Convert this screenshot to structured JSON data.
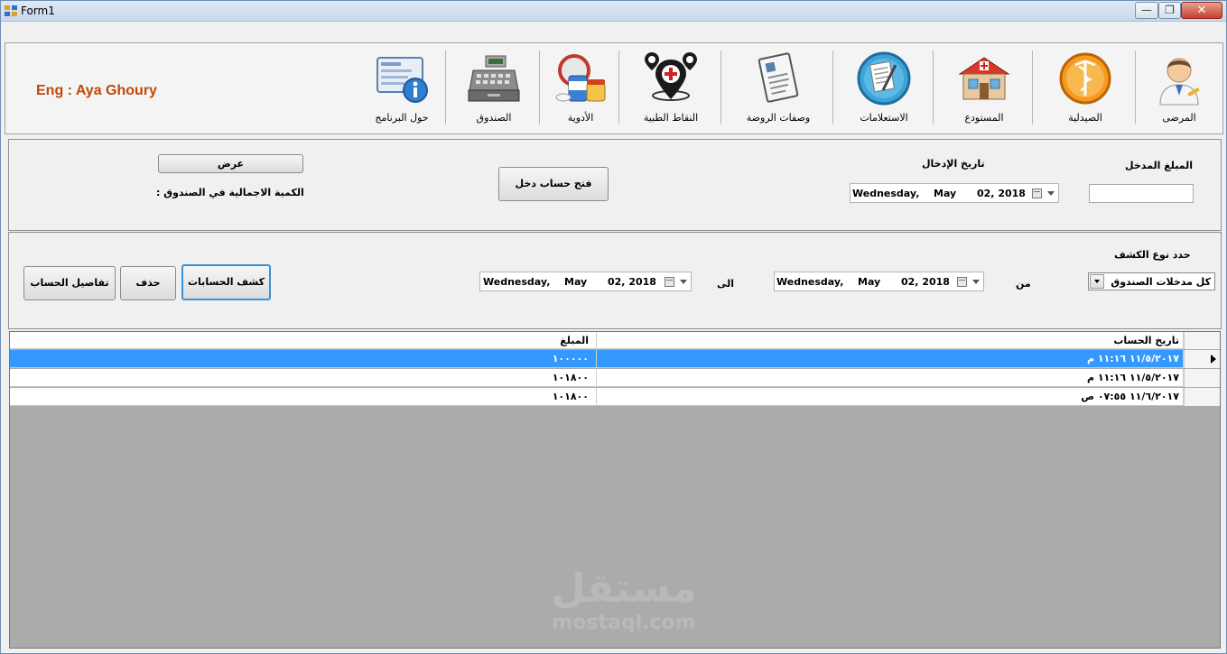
{
  "window": {
    "title": "Form1",
    "minimize": "0",
    "maximize": "1",
    "close": "r"
  },
  "toolbar": {
    "author": "Eng : Aya Ghoury",
    "items": [
      {
        "label": "حول البرنامج",
        "icon": "info-icon"
      },
      {
        "label": "الصندوق",
        "icon": "cash-register-icon"
      },
      {
        "label": "الأدوية",
        "icon": "medicine-icon"
      },
      {
        "label": "النقاط الطبية",
        "icon": "medical-pins-icon"
      },
      {
        "label": "وصفات الروضة",
        "icon": "prescription-icon"
      },
      {
        "label": "الاستعلامات",
        "icon": "query-icon"
      },
      {
        "label": "المستودع",
        "icon": "warehouse-icon"
      },
      {
        "label": "الصيدلية",
        "icon": "pharmacy-icon"
      },
      {
        "label": "المرضى",
        "icon": "patient-icon"
      }
    ]
  },
  "entry": {
    "amount_label": "المبلغ المدخل",
    "amount_value": "",
    "date_label": "تاريخ الإدخال",
    "date_day": "Wednesday,",
    "date_month": "May",
    "date_rest": "02, 2018",
    "open_button": "فتح حساب دخل",
    "show_button": "عرض",
    "total_label": "الكمية الاجمالية في الصندوق :"
  },
  "report": {
    "type_label": "حدد نوع الكشف",
    "type_value": "كل مدخلات الصندوق",
    "from_label": "من",
    "to_label": "الى",
    "from_day": "Wednesday,",
    "from_month": "May",
    "from_rest": "02, 2018",
    "to_day": "Wednesday,",
    "to_month": "May",
    "to_rest": "02, 2018",
    "statement_button": "كشف الحسابات",
    "delete_button": "حذف",
    "details_button": "تفاصيل الحساب"
  },
  "grid": {
    "columns": [
      "تاريخ الحساب",
      "المبلغ"
    ],
    "rows": [
      {
        "date": "١١/٥/٢٠١٧ ١١:١٦ م",
        "amount": "١٠٠٠٠٠"
      },
      {
        "date": "١١/٥/٢٠١٧ ١١:١٦ م",
        "amount": "١٠١٨٠٠"
      },
      {
        "date": "١١/٦/٢٠١٧ ٠٧:٥٥ ص",
        "amount": "١٠١٨٠٠"
      }
    ]
  },
  "watermark": {
    "arabic": "مستقل",
    "latin": "mostaql.com"
  }
}
